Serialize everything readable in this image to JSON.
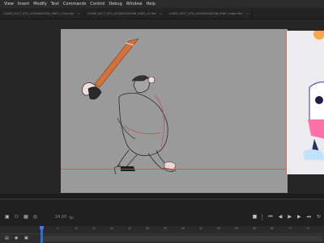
{
  "menu": [
    "View",
    "Insert",
    "Modify",
    "Text",
    "Commands",
    "Control",
    "Debug",
    "Window",
    "Help"
  ],
  "tabs": [
    {
      "label": "c1085_9917_075_12000892036_9987_c2d.b.fla*"
    },
    {
      "label": "c1085_9917_075_UC0000020036_9987_c0 fla*"
    },
    {
      "label": "c1085_9917_075_UC0000020036_9987_fragm.fla*"
    }
  ],
  "timeline": {
    "fps_value": "24.00",
    "fps_unit": "fps",
    "ruler_ticks": [
      "5",
      "10",
      "15",
      "20",
      "25",
      "30",
      "35",
      "40",
      "45",
      "50",
      "55",
      "60",
      "65",
      "70",
      "75"
    ]
  },
  "colors": {
    "stage_bg": "#9a9a9a",
    "bat": "#d4703a",
    "accent_red": "#c55050",
    "playhead": "#2f6fdd"
  },
  "icons": [
    "camera-icon",
    "bone-icon",
    "layers-icon",
    "onion-skin-icon",
    "stop-icon",
    "rewind-icon",
    "step-back-icon",
    "play-icon",
    "step-forward-icon",
    "fast-forward-icon",
    "loop-icon"
  ]
}
